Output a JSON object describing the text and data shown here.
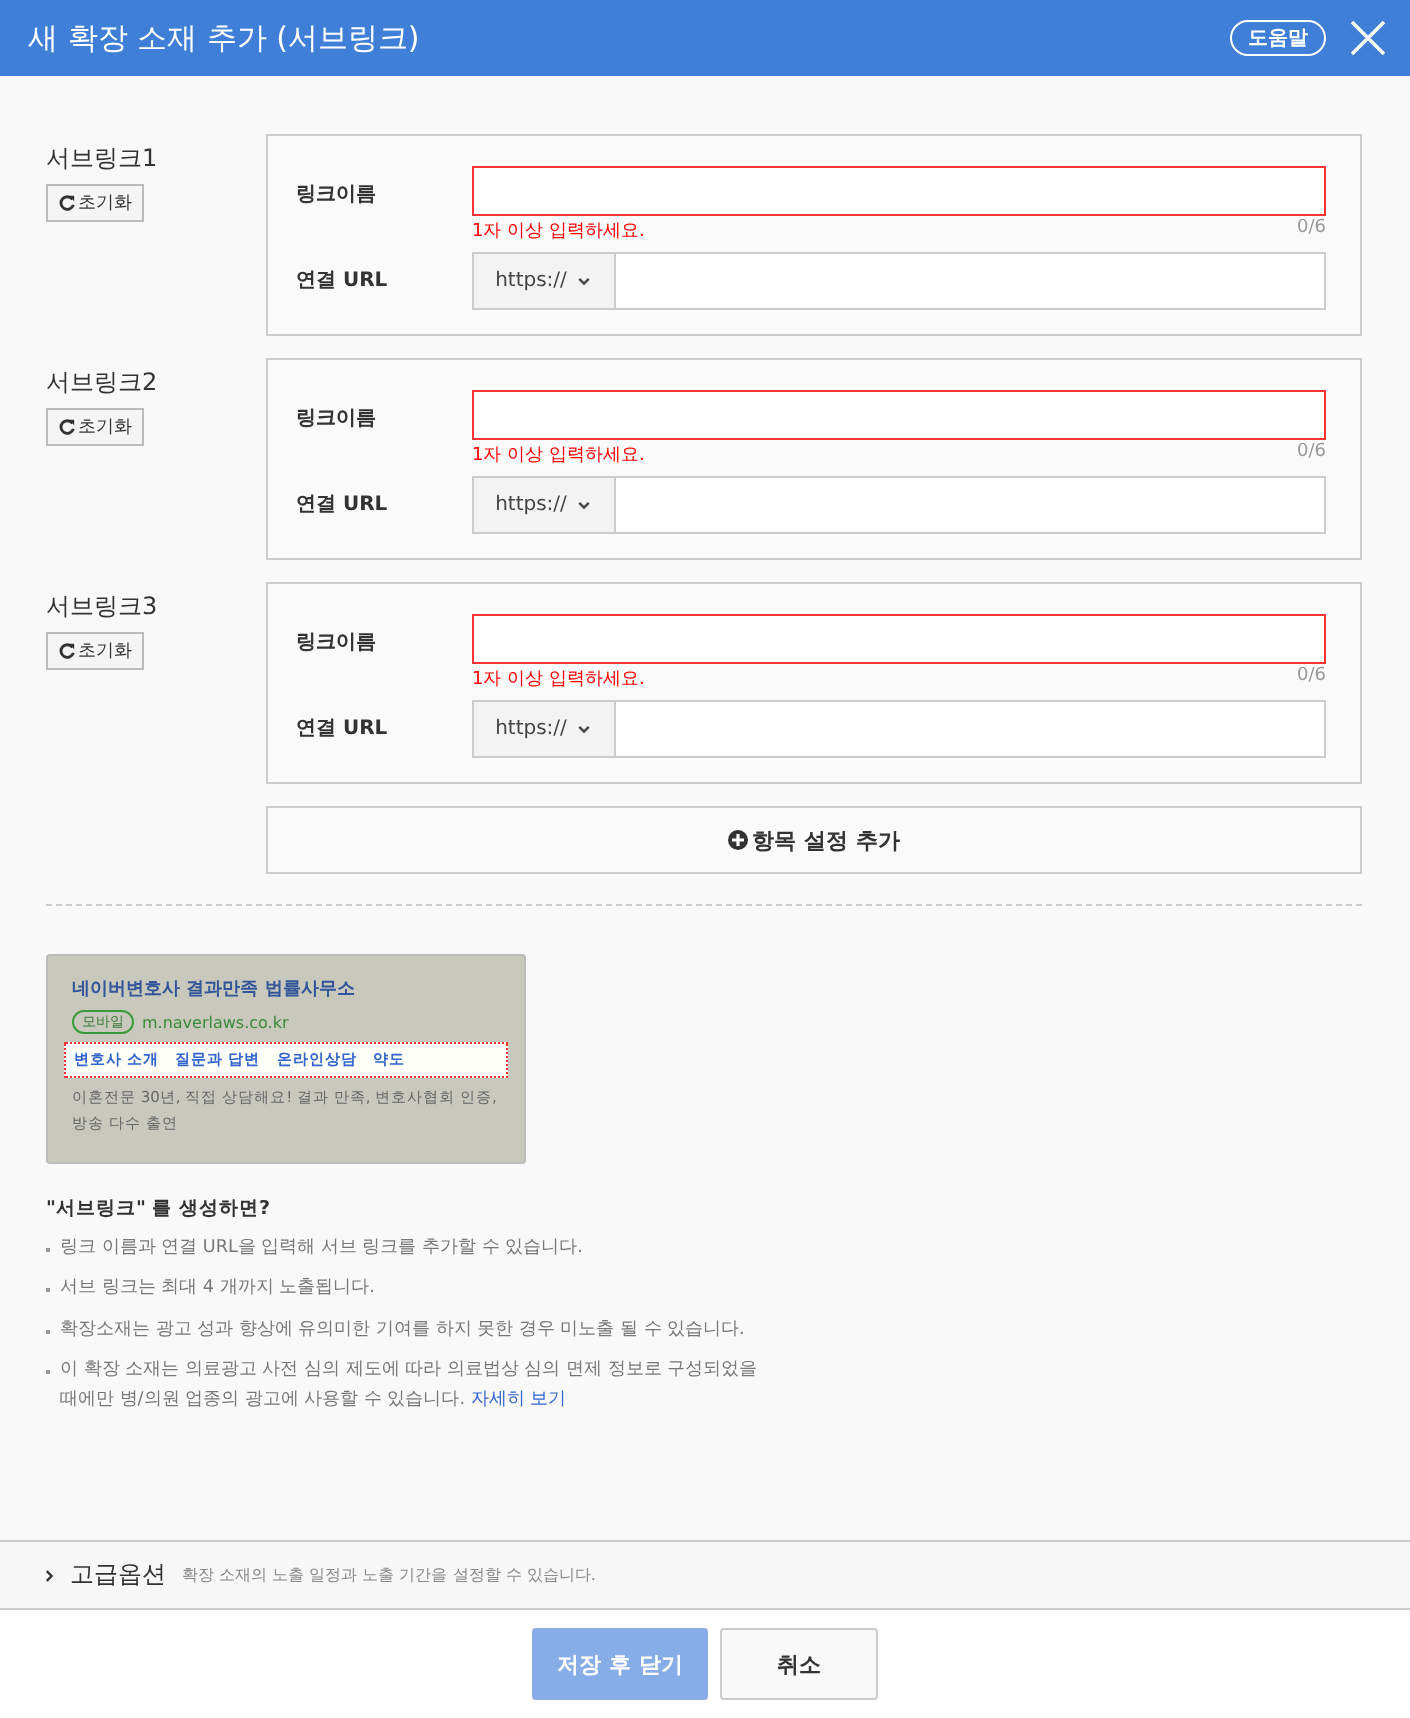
{
  "window": {
    "title": "새 확장 소재 추가 (서브링크)",
    "help_button": "도움말"
  },
  "sublinks": [
    {
      "label": "서브링크1",
      "reset": "초기화",
      "name_label": "링크이름",
      "error": "1자 이상 입력하세요.",
      "counter": "0/6",
      "url_label": "연결 URL",
      "protocol": "https://"
    },
    {
      "label": "서브링크2",
      "reset": "초기화",
      "name_label": "링크이름",
      "error": "1자 이상 입력하세요.",
      "counter": "0/6",
      "url_label": "연결 URL",
      "protocol": "https://"
    },
    {
      "label": "서브링크3",
      "reset": "초기화",
      "name_label": "링크이름",
      "error": "1자 이상 입력하세요.",
      "counter": "0/6",
      "url_label": "연결 URL",
      "protocol": "https://"
    }
  ],
  "add_button": "항목 설정 추가",
  "preview": {
    "title": "네이버변호사 결과만족 법률사무소",
    "badge": "모바일",
    "url": "m.naverlaws.co.kr",
    "links": [
      "변호사 소개",
      "질문과 답변",
      "온라인상담",
      "약도"
    ],
    "description": "이혼전문 30년, 직접 상담해요! 결과 만족, 변호사협회 인증, 방송 다수 출연"
  },
  "info": {
    "heading": "\"서브링크\" 를 생성하면?",
    "items": [
      {
        "text": "링크 이름과 연결 URL을 입력해 서브 링크를 추가할 수 있습니다."
      },
      {
        "text": "서브 링크는 최대 4 개까지 노출됩니다."
      },
      {
        "text": "확장소재는 광고 성과 향상에 유의미한 기여를 하지 못한 경우 미노출 될 수 있습니다."
      },
      {
        "text": "이 확장 소재는 의료광고 사전 심의 제도에 따라 의료법상 심의 면제 정보로 구성되었을 때에만 병/의원 업종의 광고에 사용할 수 있습니다.",
        "link": "자세히 보기"
      }
    ]
  },
  "advanced": {
    "label": "고급옵션",
    "description": "확장 소재의 노출 일정과 노출 기간을 설정할 수 있습니다.",
    "expanded": false
  },
  "buttons": [
    {
      "label": "저장 후 닫기",
      "kind": "primary",
      "disabled": true
    },
    {
      "label": "취소",
      "kind": "secondary",
      "disabled": false
    }
  ]
}
